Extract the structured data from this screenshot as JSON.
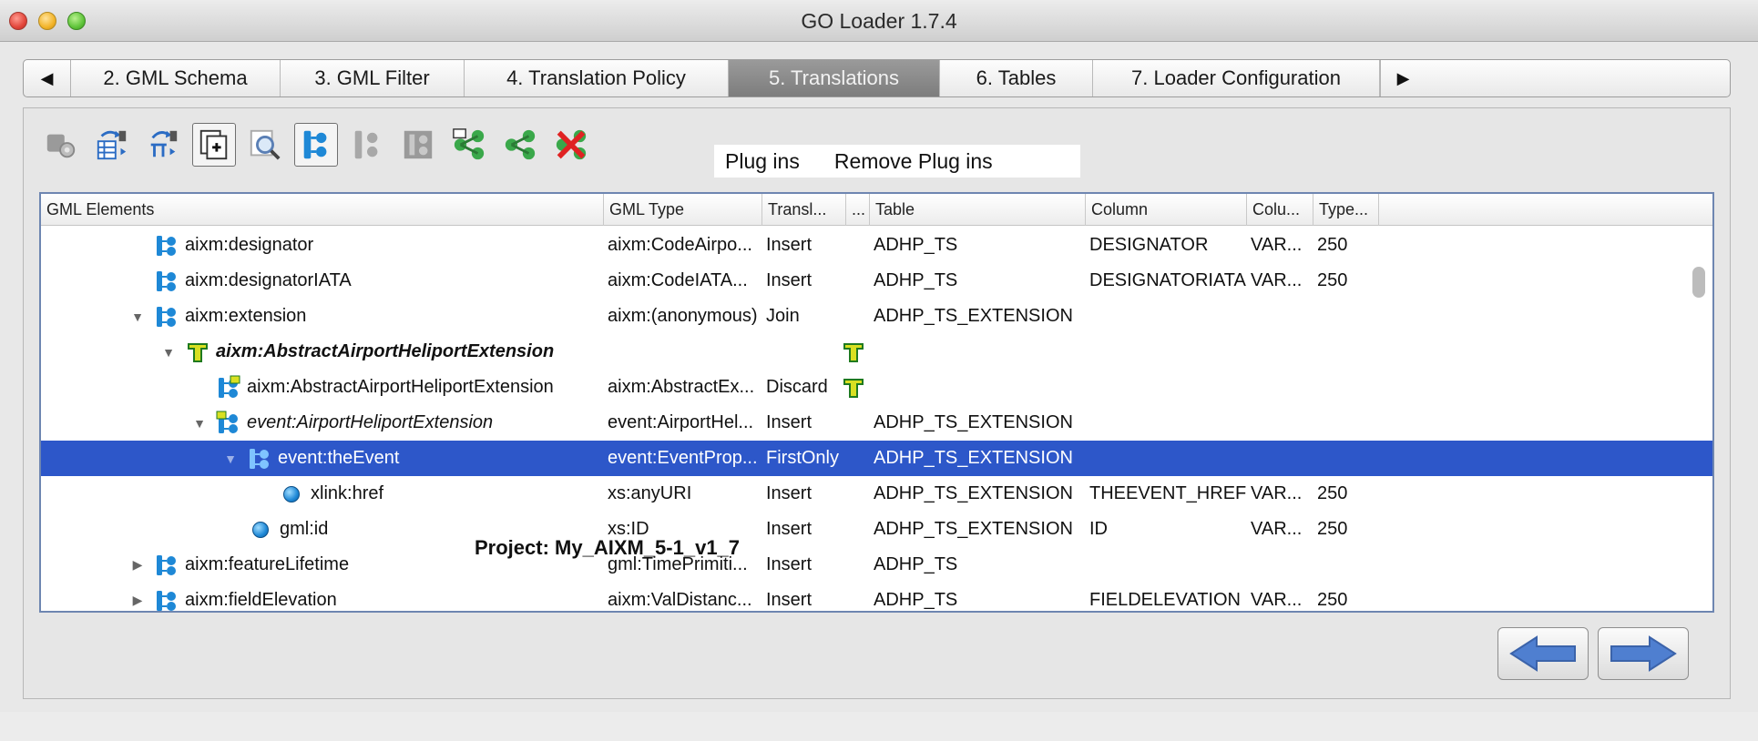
{
  "window": {
    "title": "GO Loader 1.7.4"
  },
  "tabs": [
    {
      "label": "2. GML Schema",
      "active": false
    },
    {
      "label": "3. GML Filter",
      "active": false
    },
    {
      "label": "4. Translation Policy",
      "active": false
    },
    {
      "label": "5. Translations",
      "active": true
    },
    {
      "label": "6. Tables",
      "active": false
    },
    {
      "label": "7. Loader Configuration",
      "active": false
    }
  ],
  "tab_nav": {
    "prev_glyph": "◀",
    "next_glyph": "▶"
  },
  "plugins": {
    "plug_ins": "Plug ins",
    "remove_plug_ins": "Remove Plug ins"
  },
  "table": {
    "columns": [
      "GML Elements",
      "GML Type",
      "Transl...",
      "...",
      "Table",
      "Column",
      "Colu...",
      "Type..."
    ],
    "rows": [
      {
        "element": "aixm:designator",
        "gml_type": "aixm:CodeAirpo...",
        "translation": "Insert",
        "table": "ADHP_TS",
        "column": "DESIGNATOR",
        "col_type": "VAR...",
        "type_len": "250"
      },
      {
        "element": "aixm:designatorIATA",
        "gml_type": "aixm:CodeIATA...",
        "translation": "Insert",
        "table": "ADHP_TS",
        "column": "DESIGNATORIATA",
        "col_type": "VAR...",
        "type_len": "250"
      },
      {
        "element": "aixm:extension",
        "gml_type": "aixm:(anonymous)",
        "translation": "Join",
        "table": "ADHP_TS_EXTENSION",
        "column": "",
        "col_type": "",
        "type_len": ""
      },
      {
        "element": "aixm:AbstractAirportHeliportExtension",
        "gml_type": "",
        "translation": "",
        "table": "",
        "column": "",
        "col_type": "",
        "type_len": ""
      },
      {
        "element": "aixm:AbstractAirportHeliportExtension",
        "gml_type": "aixm:AbstractEx...",
        "translation": "Discard",
        "table": "",
        "column": "",
        "col_type": "",
        "type_len": ""
      },
      {
        "element": "event:AirportHeliportExtension",
        "gml_type": "event:AirportHel...",
        "translation": "Insert",
        "table": "ADHP_TS_EXTENSION",
        "column": "",
        "col_type": "",
        "type_len": ""
      },
      {
        "element": "event:theEvent",
        "gml_type": "event:EventProp...",
        "translation": "FirstOnly",
        "table": "ADHP_TS_EXTENSION",
        "column": "",
        "col_type": "",
        "type_len": ""
      },
      {
        "element": "xlink:href",
        "gml_type": "xs:anyURI",
        "translation": "Insert",
        "table": "ADHP_TS_EXTENSION",
        "column": "THEEVENT_HREF",
        "col_type": "VAR...",
        "type_len": "250"
      },
      {
        "element": "gml:id",
        "gml_type": "xs:ID",
        "translation": "Insert",
        "table": "ADHP_TS_EXTENSION",
        "column": "ID",
        "col_type": "VAR...",
        "type_len": "250"
      },
      {
        "element": "aixm:featureLifetime",
        "gml_type": "gml:TimePrimiti...",
        "translation": "Insert",
        "table": "ADHP_TS",
        "column": "",
        "col_type": "",
        "type_len": ""
      },
      {
        "element": "aixm:fieldElevation",
        "gml_type": "aixm:ValDistanc...",
        "translation": "Insert",
        "table": "ADHP_TS",
        "column": "FIELDELEVATION",
        "col_type": "VAR...",
        "type_len": "250"
      }
    ]
  },
  "footer": {
    "project": "Project: My_AIXM_5-1_v1_7"
  },
  "colors": {
    "selection": "#2d57c9",
    "icon_blue": "#1e88d6",
    "icon_yellow": "#d9e021",
    "arrow_blue": "#4f7fd0"
  }
}
